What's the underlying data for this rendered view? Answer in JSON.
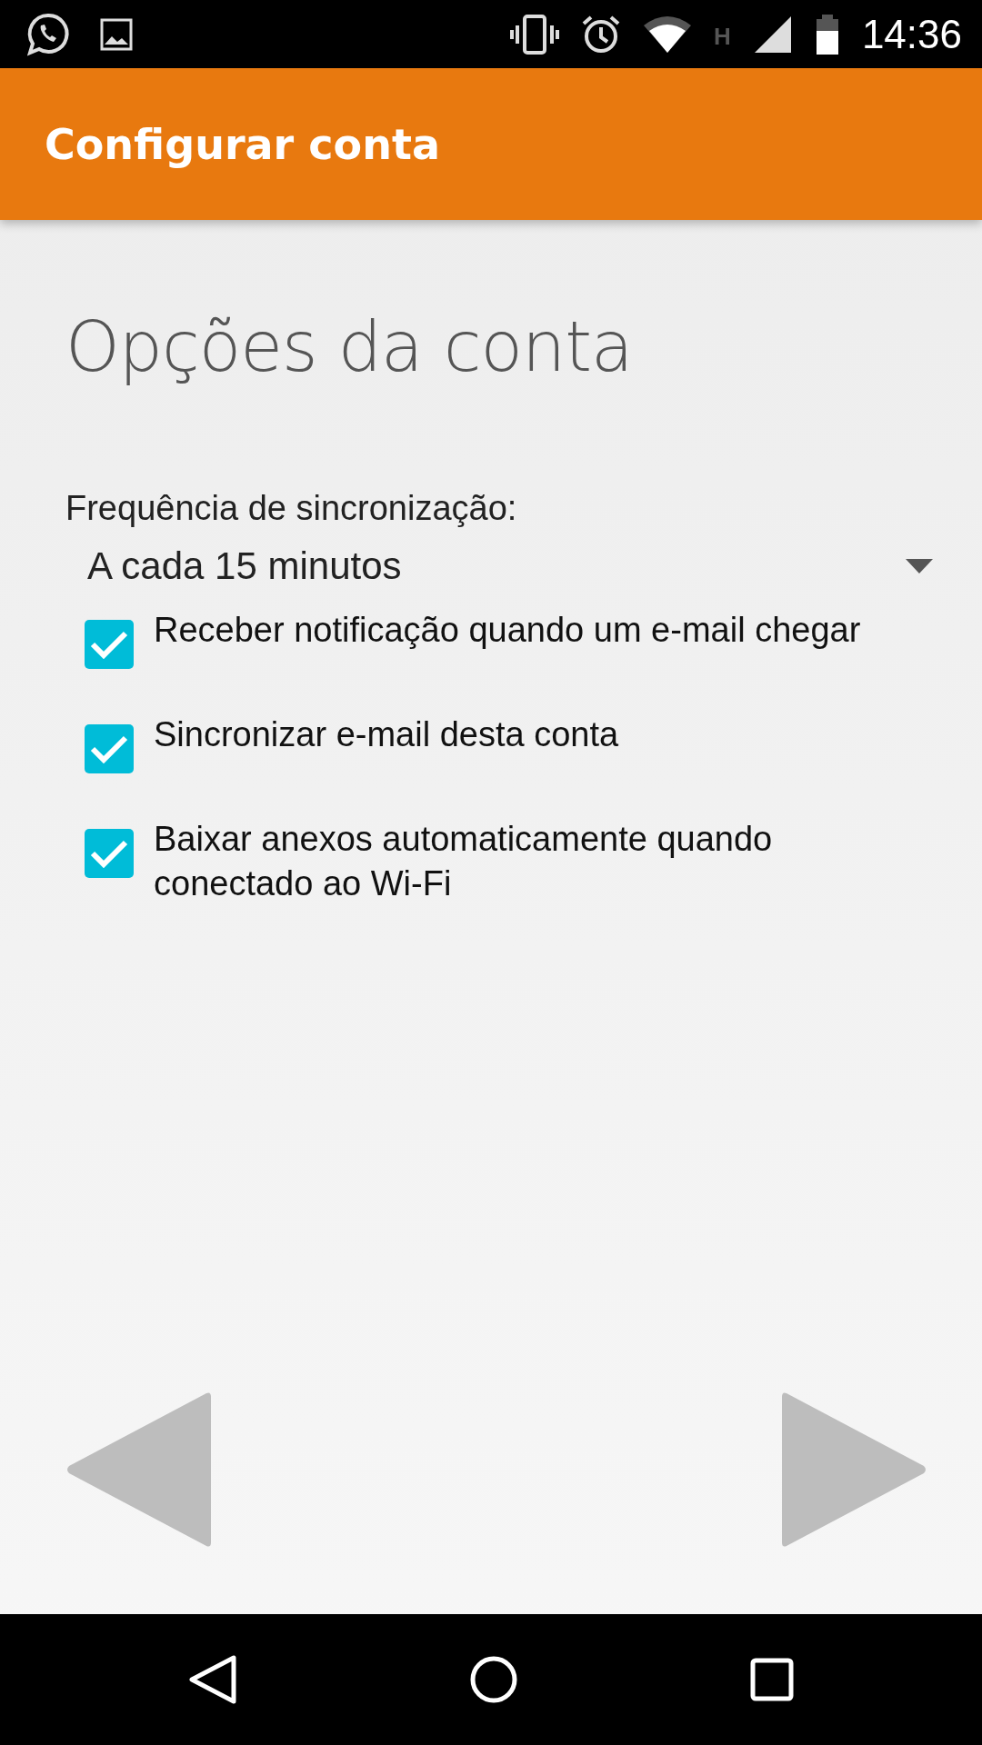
{
  "status_bar": {
    "network_type": "H",
    "time": "14:36"
  },
  "app_bar": {
    "title": "Configurar conta"
  },
  "heading": "Opções da conta",
  "sync_frequency": {
    "label": "Frequência de sincronização:",
    "value": "A cada 15 minutos"
  },
  "options": [
    {
      "label": "Receber notificação quando um e-mail chegar",
      "checked": true
    },
    {
      "label": "Sincronizar e-mail desta conta",
      "checked": true
    },
    {
      "label": "Baixar anexos automaticamente quando conectado ao Wi-Fi",
      "checked": true
    }
  ]
}
